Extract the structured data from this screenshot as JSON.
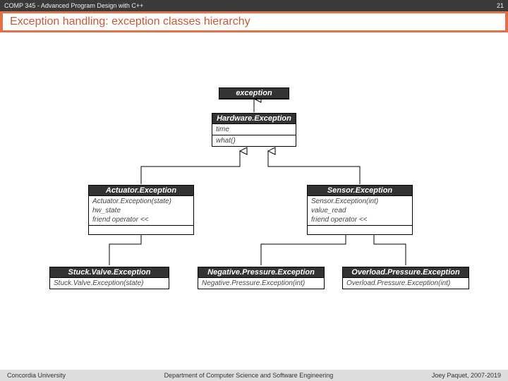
{
  "header": {
    "course": "COMP 345 - Advanced Program Design with C++",
    "slide_number": "21",
    "title": "Exception handling: exception classes hierarchy"
  },
  "footer": {
    "left": "Concordia University",
    "center": "Department of Computer Science and Software Engineering",
    "right": "Joey Paquet, 2007-2019"
  },
  "classes": {
    "exception": {
      "name": "exception",
      "members": "",
      "methods": ""
    },
    "hardware": {
      "name": "Hardware.Exception",
      "members": "time",
      "methods": "what()"
    },
    "actuator": {
      "name": "Actuator.Exception",
      "members": "Actuator.Exception(state)\nhw_state\nfriend operator <<",
      "methods": ""
    },
    "sensor": {
      "name": "Sensor.Exception",
      "members": "Sensor.Exception(int)\nvalue_read\nfriend operator <<",
      "methods": ""
    },
    "stuckvalve": {
      "name": "Stuck.Valve.Exception",
      "members": "Stuck.Valve.Exception(state)",
      "methods": ""
    },
    "negpressure": {
      "name": "Negative.Pressure.Exception",
      "members": "Negative.Pressure.Exception(int)",
      "methods": ""
    },
    "overpressure": {
      "name": "Overload.Pressure.Exception",
      "members": "Overload.Pressure.Exception(int)",
      "methods": ""
    }
  }
}
